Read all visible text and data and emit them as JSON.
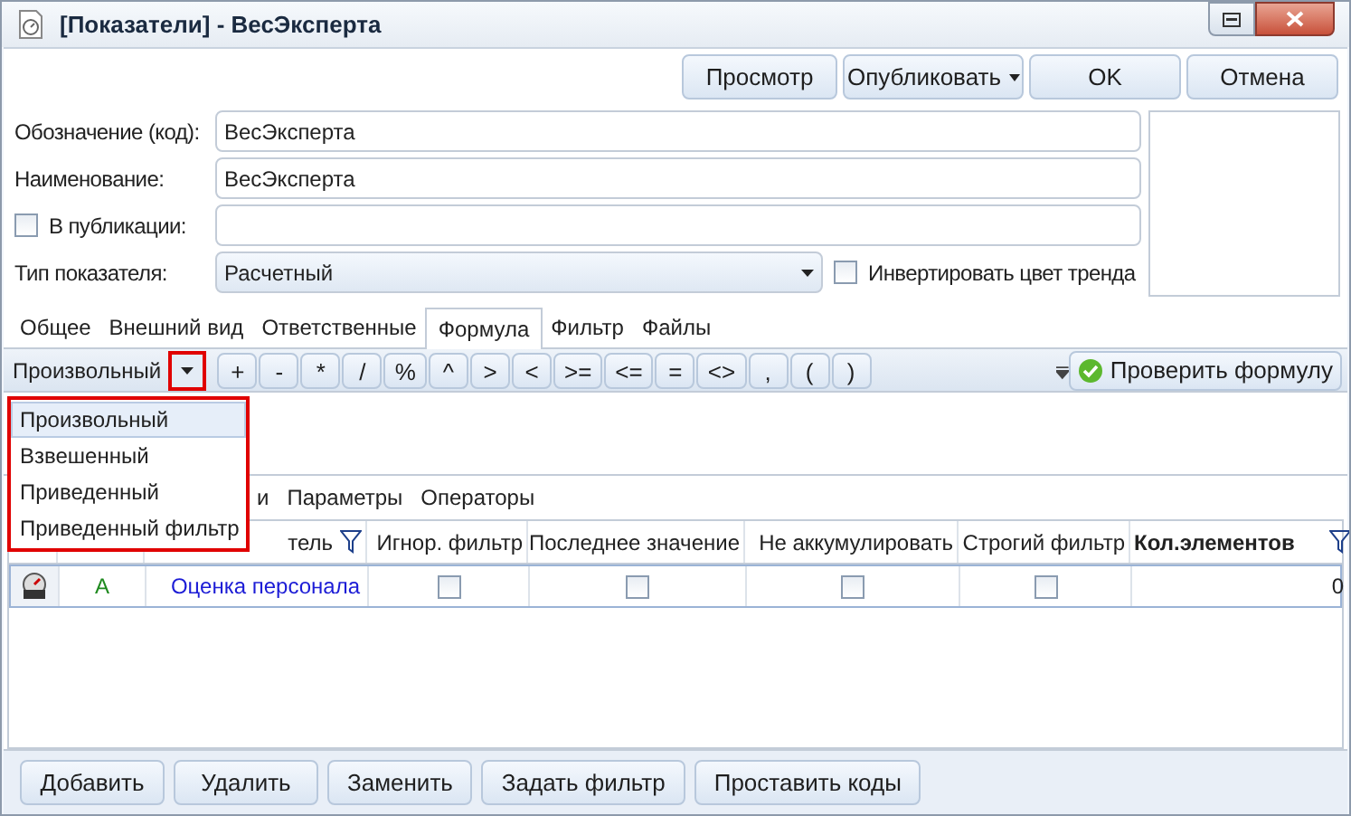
{
  "window": {
    "title": "[Показатели] - ВесЭксперта"
  },
  "toolbar": [
    {
      "label": "Просмотр",
      "kind": "plain"
    },
    {
      "label": "Опубликовать",
      "kind": "menu"
    },
    {
      "label": "OK",
      "kind": "plain"
    },
    {
      "label": "Отмена",
      "kind": "plain"
    }
  ],
  "fields": [
    {
      "label": "Обозначение (код):",
      "value": "ВесЭксперта",
      "kind": "text"
    },
    {
      "label": "Наименование:",
      "value": "ВесЭксперта",
      "kind": "text"
    },
    {
      "label": "В публикации:",
      "kind": "check",
      "checked": false
    },
    {
      "label": "Тип показателя:",
      "value": "Расчетный",
      "kind": "select"
    }
  ],
  "invert_trend": {
    "label": "Инвертировать цвет тренда",
    "checked": false
  },
  "tabs": [
    {
      "label": "Общее",
      "selected": false
    },
    {
      "label": "Внешний вид",
      "selected": false
    },
    {
      "label": "Ответственные",
      "selected": false
    },
    {
      "label": "Формула",
      "selected": true
    },
    {
      "label": "Фильтр",
      "selected": false
    },
    {
      "label": "Файлы",
      "selected": false
    }
  ],
  "formula_type": {
    "value": "Произвольный",
    "options": [
      {
        "label": "Произвольный",
        "selected": true
      },
      {
        "label": "Взвешенный",
        "selected": false
      },
      {
        "label": "Приведенный",
        "selected": false
      },
      {
        "label": "Приведенный фильтр",
        "selected": false
      }
    ]
  },
  "operators": [
    "+",
    "-",
    "*",
    "/",
    "%",
    "^",
    ">",
    "<",
    ">=",
    "<=",
    "=",
    "<>",
    ",",
    "(",
    ")"
  ],
  "check_formula": "Проверить формулу",
  "subtabs": [
    "и",
    "Параметры",
    "Операторы"
  ],
  "table": {
    "columns": [
      {
        "kind": "icon"
      },
      {
        "kind": "code"
      },
      {
        "label": "тель",
        "kind": "filter"
      },
      {
        "label": "Игнор. фильтр",
        "kind": "plain"
      },
      {
        "label": "Последнее значение",
        "kind": "plain"
      },
      {
        "label": "Не аккумулировать",
        "kind": "plain"
      },
      {
        "label": "Строгий фильтр",
        "kind": "plain"
      },
      {
        "label": "Кол.элементов",
        "kind": "bold-filter"
      }
    ],
    "rows": [
      {
        "code": "А",
        "name": "Оценка персонала",
        "ignore_filter": false,
        "last_value": false,
        "no_accumulate": false,
        "strict_filter": false,
        "count": "0"
      }
    ]
  },
  "bottom_buttons": [
    "Добавить",
    "Удалить",
    "Заменить",
    "Задать фильтр",
    "Проставить коды"
  ]
}
